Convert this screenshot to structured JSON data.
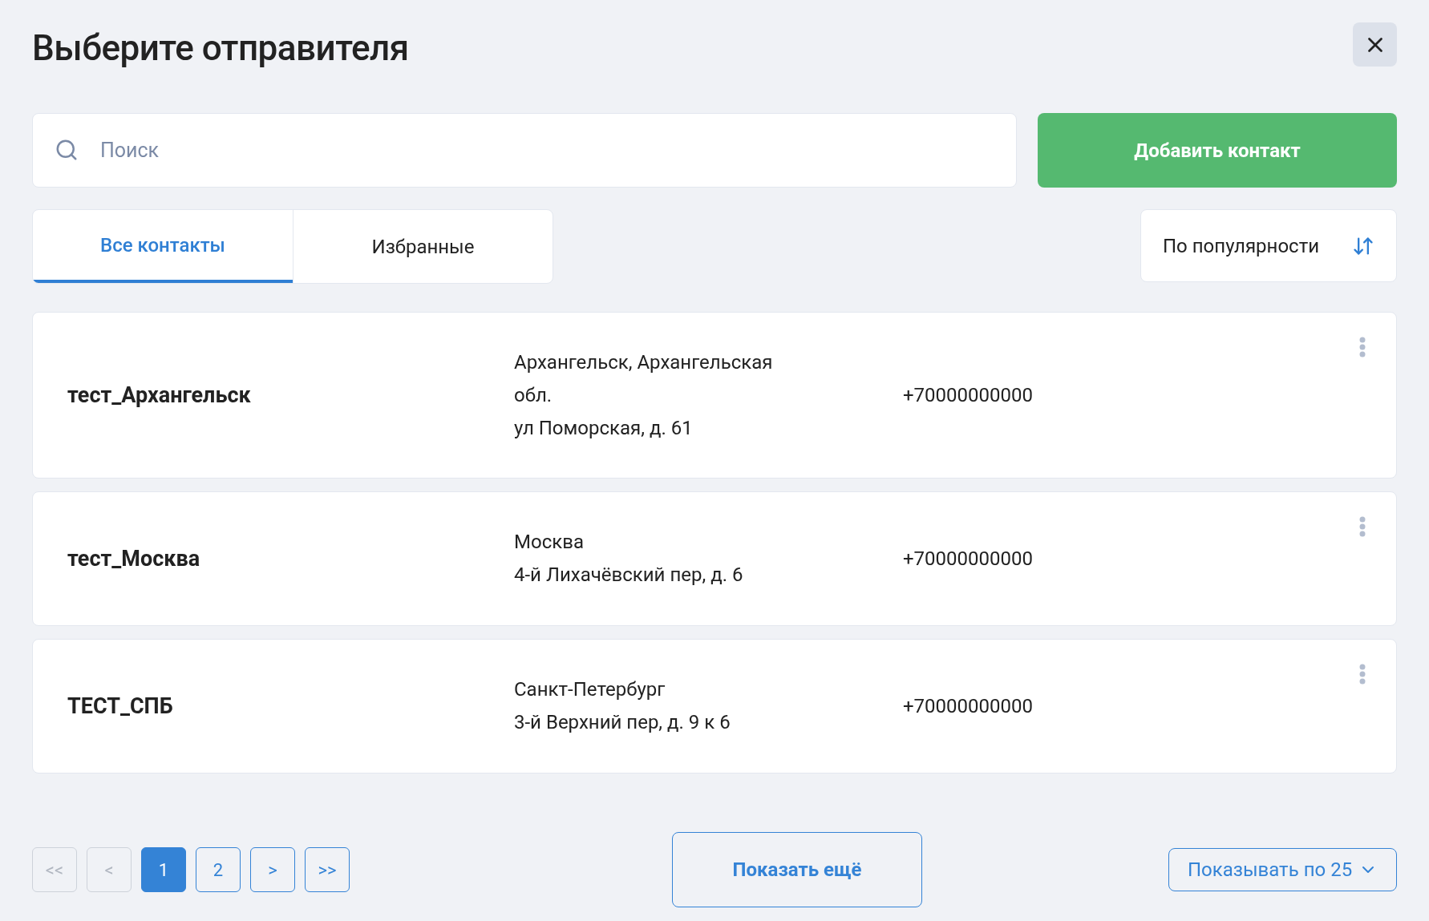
{
  "title": "Выберите отправителя",
  "search": {
    "placeholder": "Поиск"
  },
  "add_button": "Добавить контакт",
  "tabs": [
    {
      "label": "Все контакты",
      "selected": true
    },
    {
      "label": "Избранные",
      "selected": false
    }
  ],
  "sort": {
    "label": "По популярности"
  },
  "contacts": [
    {
      "name": "тест_Архангельск",
      "address": [
        "Архангельск, Архангельская",
        "обл.",
        "ул Поморская, д. 61"
      ],
      "phone": "+70000000000"
    },
    {
      "name": "тест_Москва",
      "address": [
        "Москва",
        "4-й Лихачёвский пер, д. 6"
      ],
      "phone": "+70000000000"
    },
    {
      "name": "ТЕСТ_СПБ",
      "address": [
        "Санкт-Петербург",
        "3-й Верхний пер, д. 9 к 6"
      ],
      "phone": "+70000000000"
    }
  ],
  "pagination": [
    {
      "label": "<<",
      "disabled": true,
      "selected": false
    },
    {
      "label": "<",
      "disabled": true,
      "selected": false
    },
    {
      "label": "1",
      "disabled": false,
      "selected": true
    },
    {
      "label": "2",
      "disabled": false,
      "selected": false
    },
    {
      "label": ">",
      "disabled": false,
      "selected": false
    },
    {
      "label": ">>",
      "disabled": false,
      "selected": false
    }
  ],
  "show_more": "Показать ещё",
  "per_page": "Показывать по 25"
}
